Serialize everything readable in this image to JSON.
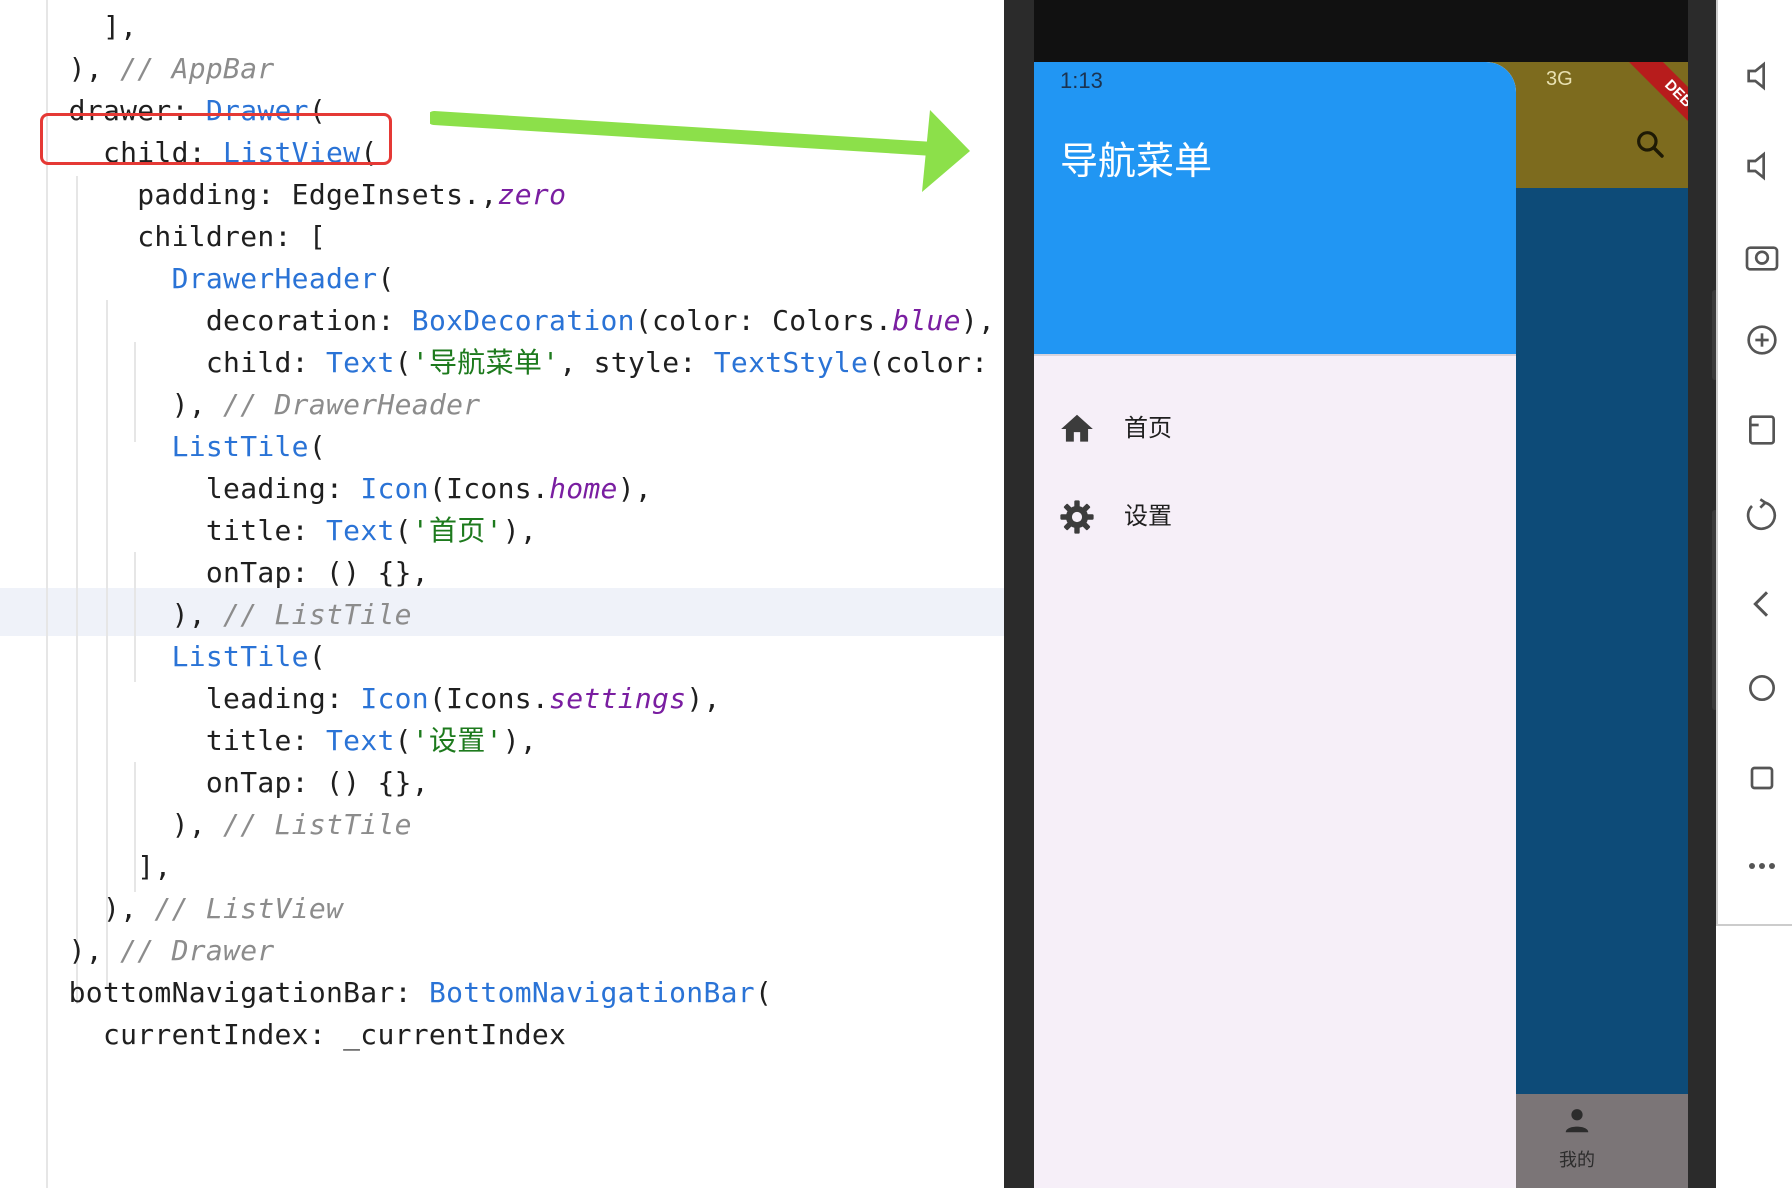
{
  "editor": {
    "lines": [
      {
        "t": "      ],"
      },
      {
        "t": "    ), ",
        "c": "// AppBar"
      },
      {
        "t": "    drawer: ",
        "k": "Drawer",
        "r": "("
      },
      {
        "t": "      child: ",
        "k": "ListView",
        "r": "("
      },
      {
        "t": "        padding: EdgeInsets.",
        "i": "zero",
        "r": ","
      },
      {
        "t": "        children: ["
      },
      {
        "t": "          ",
        "k": "DrawerHeader",
        "r": "("
      },
      {
        "t": "            decoration: ",
        "k": "BoxDecoration",
        "r": "(color: Colors.",
        "i": "blue",
        "r2": "),"
      },
      {
        "t": "            child: ",
        "k": "Text",
        "r": "(",
        "s": "'导航菜单'",
        "r2": ", style: ",
        "k2": "TextStyle",
        "r3": "(color: Co"
      },
      {
        "t": "          ), ",
        "c": "// DrawerHeader"
      },
      {
        "t": "          ",
        "k": "ListTile",
        "r": "("
      },
      {
        "t": "            leading: ",
        "k": "Icon",
        "r": "(Icons.",
        "i": "home",
        "r2": "),"
      },
      {
        "t": "            title: ",
        "k": "Text",
        "r": "(",
        "s": "'首页'",
        "r2": "),"
      },
      {
        "t": "            onTap: () {},"
      },
      {
        "t": "          ), ",
        "c": "// ListTile"
      },
      {
        "t": "          ",
        "k": "ListTile",
        "r": "("
      },
      {
        "t": "            leading: ",
        "k": "Icon",
        "r": "(Icons.",
        "i": "settings",
        "r2": "),"
      },
      {
        "t": "            title: ",
        "k": "Text",
        "r": "(",
        "s": "'设置'",
        "r2": "),"
      },
      {
        "t": "            onTap: () {},"
      },
      {
        "t": "          ), ",
        "c": "// ListTile"
      },
      {
        "t": "        ],"
      },
      {
        "t": "      ), ",
        "c": "// ListView"
      },
      {
        "t": "    ), ",
        "c": "// Drawer"
      },
      {
        "t": "    bottomNavigationBar: ",
        "k": "BottomNavigationBar",
        "r": "("
      },
      {
        "t": "      currentIndex: _currentIndex"
      }
    ]
  },
  "phone": {
    "status_time": "1:13",
    "status_network": "3G",
    "debug_banner": "DEBUG",
    "drawer": {
      "header_title": "导航菜单",
      "items": [
        {
          "label": "首页",
          "icon": "home-icon"
        },
        {
          "label": "设置",
          "icon": "settings-icon"
        }
      ]
    },
    "bottom_nav": {
      "item_label": "我的",
      "icon": "person-icon"
    }
  },
  "colors": {
    "drawer_header": "#2196f3",
    "drawer_body": "#f6eff8",
    "appbar_scrim": "#7d6b1e",
    "content_scrim": "#0d4b78",
    "highlight_box": "#e53935",
    "arrow": "#8ce04a"
  }
}
